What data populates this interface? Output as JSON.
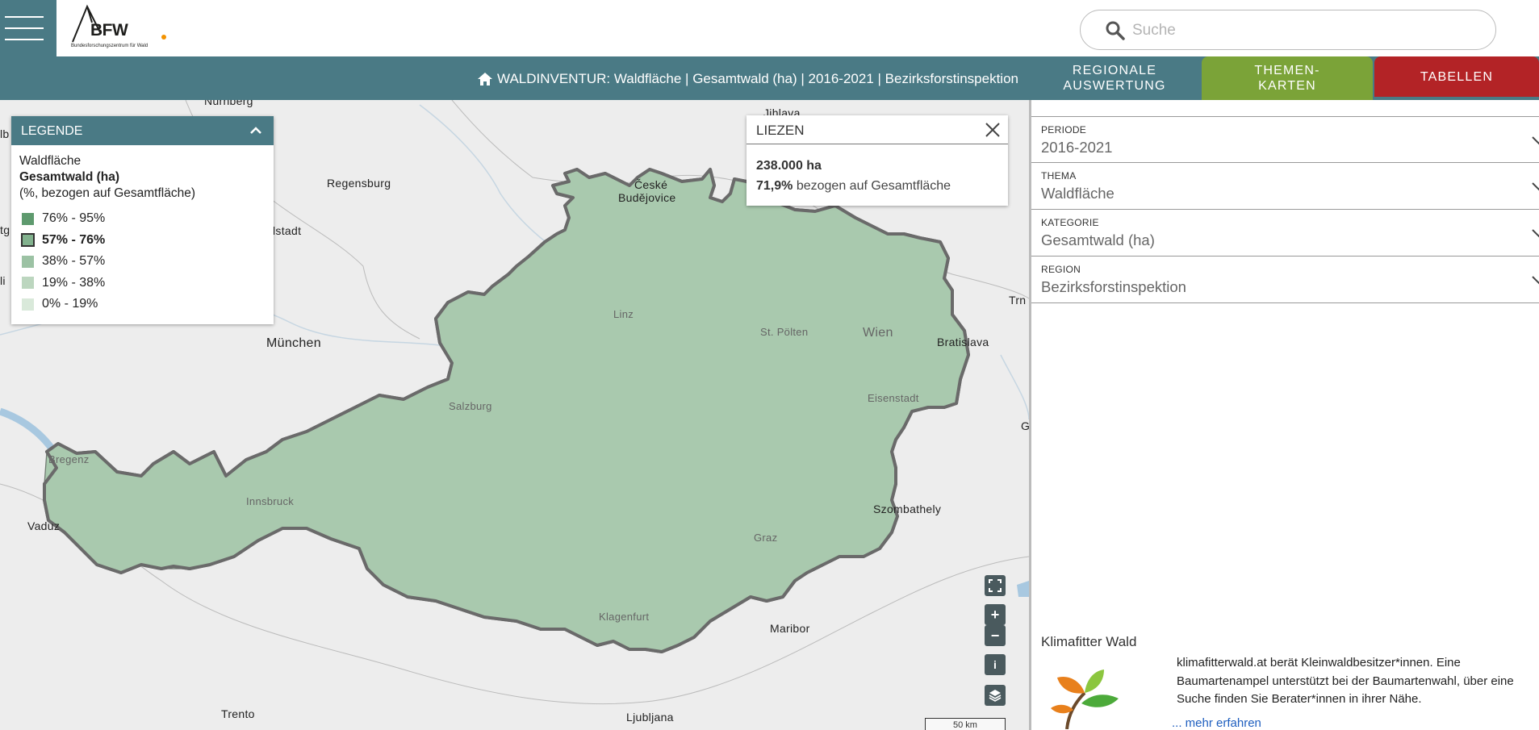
{
  "header": {
    "logo_text": "BFW",
    "logo_subtitle": "Bundesforschungszentrum für Wald",
    "search_placeholder": "Suche",
    "breadcrumb": "WALDINVENTUR: Waldfläche | Gesamtwald (ha) | 2016-2021 | Bezirksforstinspektion",
    "tabs": [
      {
        "label": "REGIONALE AUSWERTUNG",
        "color": "#4a7a85"
      },
      {
        "label": "THEMEN-KARTEN",
        "color": "#7ba338"
      },
      {
        "label": "TABELLEN",
        "color": "#b32326"
      }
    ]
  },
  "legend": {
    "title": "LEGENDE",
    "theme": "Waldfläche",
    "category": "Gesamtwald (ha)",
    "unit": "(%, bezogen auf Gesamtfläche)",
    "classes": [
      {
        "label": "76% - 95%",
        "color": "#5e9a6e",
        "active": false
      },
      {
        "label": "57% - 76%",
        "color": "#82b28e",
        "active": true
      },
      {
        "label": "38% - 57%",
        "color": "#9cc2a4",
        "active": false
      },
      {
        "label": "19% - 38%",
        "color": "#bcd6bf",
        "active": false
      },
      {
        "label": "0% - 19%",
        "color": "#d9e9da",
        "active": false
      }
    ]
  },
  "popup": {
    "region": "LIEZEN",
    "area": "238.000 ha",
    "percent": "71,9%",
    "percent_text": "bezogen auf Gesamtfläche"
  },
  "map": {
    "labels": {
      "nurnberg": "Nürnberg",
      "regensburg": "Regensburg",
      "ingolstadt": "lstadt",
      "muenchen": "München",
      "ceske": "České",
      "budejovice": "Budějovice",
      "jihlava": "Jihlava",
      "linz": "Linz",
      "stpoelten": "St. Pölten",
      "wien": "Wien",
      "bratislava": "Bratislava",
      "trn": "Trn",
      "salzburg": "Salzburg",
      "eisenstadt": "Eisenstadt",
      "g": "G",
      "bregenz": "Bregenz",
      "innsbruck": "Innsbruck",
      "vaduz": "Vaduz",
      "szombathely": "Szombathely",
      "graz": "Graz",
      "klagenfurt": "Klagenfurt",
      "maribor": "Maribor",
      "trento": "Trento",
      "ljubljana": "Ljubljana",
      "lb": "lb",
      "tg": "tg",
      "li": "li"
    },
    "scale": "50 km",
    "controls": {
      "zoom_in": "+",
      "zoom_out": "−",
      "info": "i"
    }
  },
  "panel": {
    "fields": [
      {
        "label": "PERIODE",
        "value": "2016-2021"
      },
      {
        "label": "THEMA",
        "value": "Waldfläche"
      },
      {
        "label": "KATEGORIE",
        "value": "Gesamtwald (ha)"
      },
      {
        "label": "REGION",
        "value": "Bezirksforstinspektion"
      }
    ],
    "info": {
      "title": "Klimafitter Wald",
      "text": "klimafitterwald.at berät Kleinwaldbesitzer*innen. Eine Baumartenampel unterstützt bei der Baumartenwahl, über eine Suche finden Sie Berater*innen in ihrer Nähe.",
      "link": "... mehr erfahren"
    }
  },
  "icons": [
    "menu-icon",
    "search-icon",
    "home-icon",
    "chevron-up-icon",
    "close-icon",
    "fullscreen-icon",
    "layers-icon",
    "chevron-down-icon",
    "plant-icon"
  ]
}
